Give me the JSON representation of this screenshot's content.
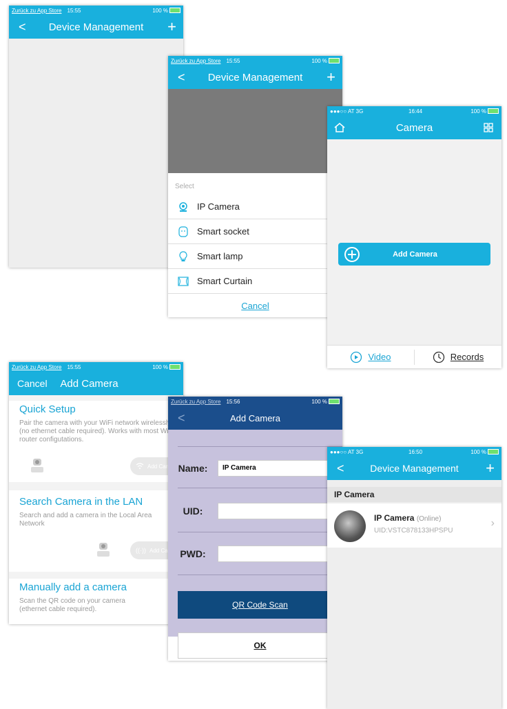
{
  "p1": {
    "status": {
      "back": "Zurück zu App Store",
      "time": "15:55",
      "battery": "100 %"
    },
    "nav": {
      "title": "Device Management",
      "back": "<",
      "add": "+"
    }
  },
  "p2": {
    "status": {
      "back": "Zurück zu App Store",
      "time": "15:55",
      "battery": "100 %"
    },
    "nav": {
      "title": "Device Management",
      "back": "<",
      "add": "+"
    },
    "sheet": {
      "title": "Select",
      "items": [
        {
          "label": "IP Camera",
          "icon": "ip-camera-icon"
        },
        {
          "label": "Smart socket",
          "icon": "smart-socket-icon"
        },
        {
          "label": "Smart lamp",
          "icon": "smart-lamp-icon"
        },
        {
          "label": "Smart Curtain",
          "icon": "smart-curtain-icon"
        }
      ],
      "cancel": "Cancel"
    }
  },
  "p3": {
    "status": {
      "carrier": "●●●○○ AT  3G",
      "time": "16:44",
      "battery": "100 %"
    },
    "nav": {
      "title": "Camera"
    },
    "add_camera": "Add Camera",
    "tabs": {
      "video": "Video",
      "records": "Records"
    }
  },
  "p4": {
    "status": {
      "back": "Zurück zu App Store",
      "time": "15:55",
      "battery": "100 %"
    },
    "nav": {
      "cancel": "Cancel",
      "title": "Add Camera"
    },
    "sections": [
      {
        "heading": "Quick Setup",
        "body": "Pair the camera with your WiFi network wirelessly (no ethernet cable required). Works with most WiFi router configutations.",
        "button": "Add Cam"
      },
      {
        "heading": "Search Camera in the LAN",
        "body": "Search and add a camera in the Local Area Network",
        "button": "Add Cam"
      },
      {
        "heading": "Manually add a camera",
        "body": "Scan the QR code on your camera (ethernet cable required)."
      }
    ]
  },
  "p5": {
    "status": {
      "back": "Zurück zu App Store",
      "time": "15:56",
      "battery": "100 %"
    },
    "nav": {
      "title": "Add Camera",
      "back": "<"
    },
    "fields": {
      "name_label": "Name:",
      "name_value": "IP Camera",
      "uid_label": "UID:",
      "pwd_label": "PWD:"
    },
    "qr_button": "QR Code Scan",
    "ok_button": "OK"
  },
  "p6": {
    "status": {
      "carrier": "●●●○○ AT  3G",
      "time": "16:50",
      "battery": "100 %"
    },
    "nav": {
      "title": "Device Management",
      "back": "<",
      "add": "+"
    },
    "section": "IP Camera",
    "device": {
      "name": "IP Camera",
      "state": "(Online)",
      "uid": "UID:VSTC878133HPSPU"
    }
  }
}
